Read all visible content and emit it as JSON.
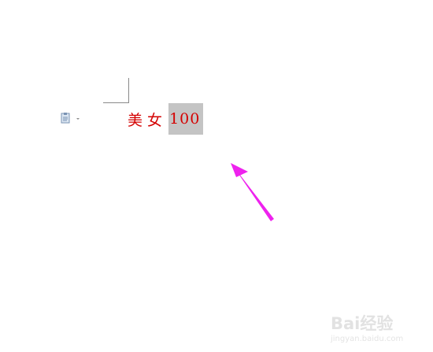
{
  "document": {
    "text_prefix": "美 女 ",
    "selected_text": "100",
    "text_color": "#d40000",
    "selection_color": "#c4c4c4"
  },
  "paste_options": {
    "icon": "clipboard-icon",
    "dropdown_icon": "chevron-down-icon"
  },
  "annotation": {
    "arrow_color": "#ee22ee"
  },
  "watermark": {
    "main": "Bai经验",
    "sub": "jingyan.baidu.com"
  }
}
